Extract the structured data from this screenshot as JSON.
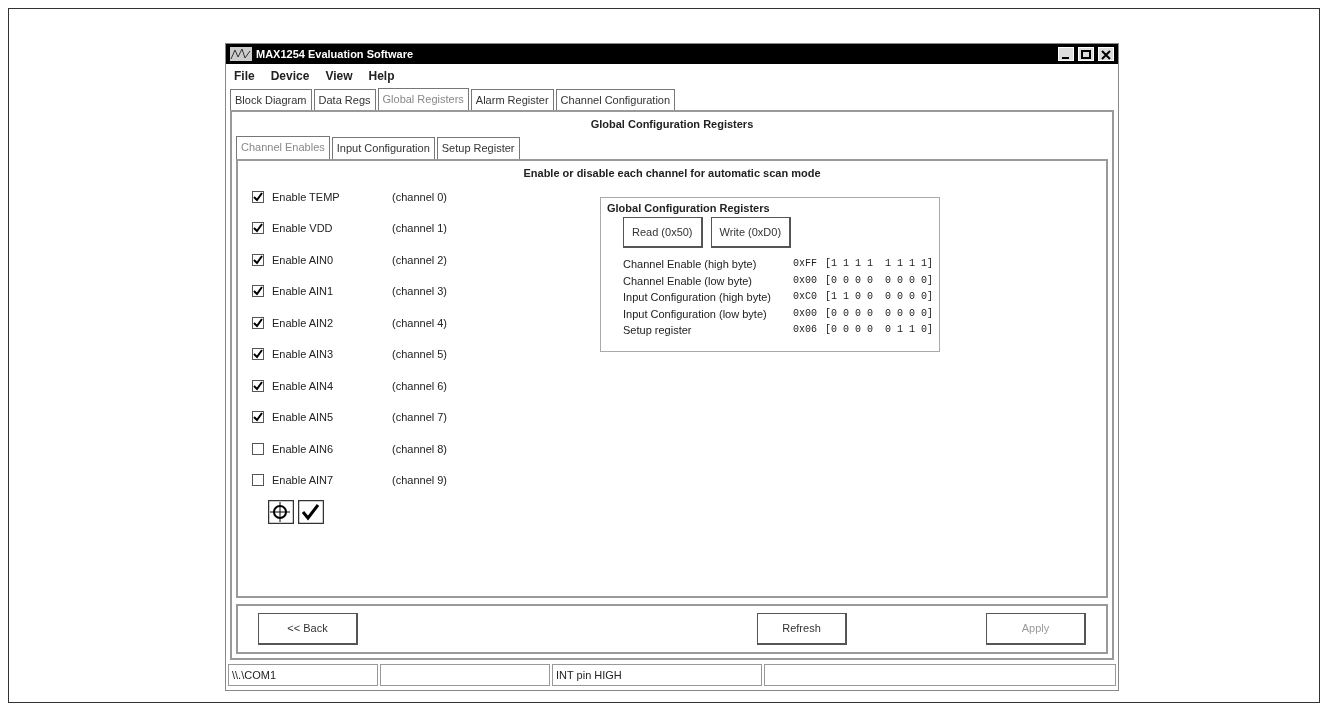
{
  "window": {
    "title": "MAX1254 Evaluation Software"
  },
  "menu": [
    "File",
    "Device",
    "View",
    "Help"
  ],
  "tabs": [
    {
      "label": "Block Diagram",
      "selected": false
    },
    {
      "label": "Data Regs",
      "selected": false
    },
    {
      "label": "Global Registers",
      "selected": true
    },
    {
      "label": "Alarm Register",
      "selected": false
    },
    {
      "label": "Channel Configuration",
      "selected": false
    }
  ],
  "panel_title": "Global Configuration Registers",
  "subtabs": [
    {
      "label": "Channel Enables",
      "selected": true
    },
    {
      "label": "Input Configuration",
      "selected": false
    },
    {
      "label": "Setup Register",
      "selected": false
    }
  ],
  "heading": "Enable or disable each channel for automatic scan mode",
  "channels": [
    {
      "label": "Enable TEMP",
      "channel": "(channel 0)",
      "checked": true
    },
    {
      "label": "Enable VDD",
      "channel": "(channel 1)",
      "checked": true
    },
    {
      "label": "Enable AIN0",
      "channel": "(channel 2)",
      "checked": true
    },
    {
      "label": "Enable AIN1",
      "channel": "(channel 3)",
      "checked": true
    },
    {
      "label": "Enable AIN2",
      "channel": "(channel 4)",
      "checked": true
    },
    {
      "label": "Enable AIN3",
      "channel": "(channel 5)",
      "checked": true
    },
    {
      "label": "Enable AIN4",
      "channel": "(channel 6)",
      "checked": true
    },
    {
      "label": "Enable AIN5",
      "channel": "(channel 7)",
      "checked": true
    },
    {
      "label": "Enable AIN6",
      "channel": "(channel 8)",
      "checked": false
    },
    {
      "label": "Enable AIN7",
      "channel": "(channel 9)",
      "checked": false
    }
  ],
  "registers": {
    "title": "Global Configuration Registers",
    "buttons": [
      "Read (0x50)",
      "Write (0xD0)"
    ],
    "rows": [
      {
        "label": "Channel Enable (high byte)",
        "hex": "0xFF",
        "bits": "[1 1 1 1  1 1 1 1]"
      },
      {
        "label": "Channel Enable (low byte)",
        "hex": "0x00",
        "bits": "[0 0 0 0  0 0 0 0]"
      },
      {
        "label": "Input Configuration (high byte)",
        "hex": "0xC0",
        "bits": "[1 1 0 0  0 0 0 0]"
      },
      {
        "label": "Input Configuration (low byte)",
        "hex": "0x00",
        "bits": "[0 0 0 0  0 0 0 0]"
      },
      {
        "label": "Setup register",
        "hex": "0x06",
        "bits": "[0 0 0 0  0 1 1 0]"
      }
    ]
  },
  "footer_buttons": [
    {
      "label": "<< Back",
      "disabled": false
    },
    {
      "label": "Refresh",
      "disabled": false
    },
    {
      "label": "Apply",
      "disabled": true
    }
  ],
  "status_bar": {
    "port": "\\\\.\\COM1",
    "int_pin": "INT pin HIGH"
  }
}
